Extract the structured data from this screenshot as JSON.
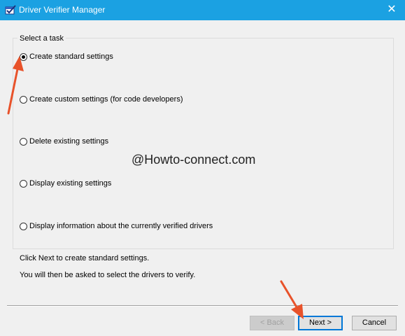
{
  "window": {
    "title": "Driver Verifier Manager",
    "close_glyph": "✕",
    "app_icon": "driver-verifier-checkmark-icon"
  },
  "task_group": {
    "label": "Select a task",
    "options": [
      {
        "label": "Create standard settings",
        "checked": true
      },
      {
        "label": "Create custom settings (for code developers)",
        "checked": false
      },
      {
        "label": "Delete existing settings",
        "checked": false
      },
      {
        "label": "Display existing settings",
        "checked": false
      },
      {
        "label": "Display information about the currently verified drivers",
        "checked": false
      }
    ]
  },
  "watermark": "@Howto-connect.com",
  "info": {
    "line1": "Click Next to create standard settings.",
    "line2": "You will then be asked to select the drivers to verify."
  },
  "buttons": {
    "back": "< Back",
    "next": "Next >",
    "cancel": "Cancel"
  },
  "colors": {
    "titlebar": "#1ba1e2",
    "annotation_arrow": "#e8522a",
    "default_button_border": "#0078d7"
  }
}
